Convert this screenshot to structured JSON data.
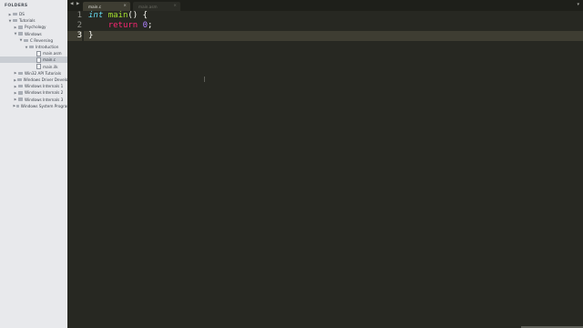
{
  "sidebar": {
    "title": "FOLDERS",
    "items": [
      {
        "label": "DS",
        "type": "folder",
        "disclosure": "▶"
      },
      {
        "label": "Tutorials",
        "type": "folder",
        "disclosure": "▼"
      },
      {
        "label": "Psychology",
        "type": "folder",
        "disclosure": "▶"
      },
      {
        "label": "Windows",
        "type": "folder",
        "disclosure": "▼"
      },
      {
        "label": "C Reversing",
        "type": "folder",
        "disclosure": "▼"
      },
      {
        "label": "Introduction",
        "type": "folder",
        "disclosure": "▼"
      },
      {
        "label": "main.asm",
        "type": "file",
        "disclosure": ""
      },
      {
        "label": "main.c",
        "type": "file",
        "disclosure": "",
        "selected": true
      },
      {
        "label": "main.ilk",
        "type": "file",
        "disclosure": ""
      },
      {
        "label": "Win32 API Tutorials",
        "type": "folder",
        "disclosure": "▶"
      },
      {
        "label": "Windows Driver Development",
        "type": "folder",
        "disclosure": "▶"
      },
      {
        "label": "Windows Internals 1",
        "type": "folder",
        "disclosure": "▶"
      },
      {
        "label": "Windows Internals 2",
        "type": "folder",
        "disclosure": "▶"
      },
      {
        "label": "Windows Internals 3",
        "type": "folder",
        "disclosure": "▶"
      },
      {
        "label": "Windows System Programming",
        "type": "folder",
        "disclosure": "▶"
      }
    ]
  },
  "tabs": {
    "nav": "◀ ▶",
    "active": {
      "label": "main.c",
      "close": "×"
    },
    "inactive": {
      "label": "main.asm",
      "close": "×"
    },
    "dropdown": "▾"
  },
  "editor": {
    "line_numbers": [
      "1",
      "2",
      "3"
    ],
    "active_line": 3,
    "lines": [
      [
        {
          "t": "int",
          "c": "kw"
        },
        {
          "t": " ",
          "c": ""
        },
        {
          "t": "main",
          "c": "fn"
        },
        {
          "t": "() {",
          "c": ""
        }
      ],
      [
        {
          "t": "    ",
          "c": ""
        },
        {
          "t": "return",
          "c": "kw2"
        },
        {
          "t": " ",
          "c": ""
        },
        {
          "t": "0",
          "c": "num"
        },
        {
          "t": ";",
          "c": ""
        }
      ],
      [
        {
          "t": "}",
          "c": ""
        }
      ]
    ]
  },
  "colors": {
    "editor_bg": "#272822",
    "sidebar_bg": "#e8e9ec",
    "keyword": "#66d9ef",
    "return_keyword": "#f92672",
    "function": "#a6e22e",
    "number": "#ae81ff",
    "text": "#f8f8f2"
  }
}
